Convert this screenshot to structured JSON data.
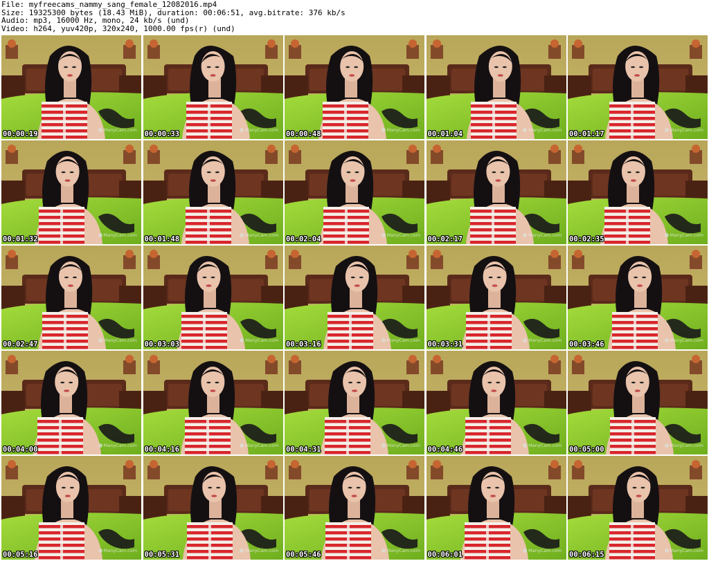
{
  "info": {
    "file": "File: myfreecams_nammy_sang_female_12082016.mp4",
    "size": "Size: 19325300 bytes (18.43 MiB), duration: 00:06:51, avg.bitrate: 376 kb/s",
    "audio": "Audio: mp3, 16000 Hz, mono, 24 kb/s (und)",
    "video": "Video: h264, yuv420p, 320x240, 1000.00 fps(r) (und)"
  },
  "watermark": "ManyCam.com",
  "thumbnails": [
    {
      "timestamp": "00:00:19"
    },
    {
      "timestamp": "00:00:33"
    },
    {
      "timestamp": "00:00:48"
    },
    {
      "timestamp": "00:01:04"
    },
    {
      "timestamp": "00:01:17"
    },
    {
      "timestamp": "00:01:32"
    },
    {
      "timestamp": "00:01:48"
    },
    {
      "timestamp": "00:02:04"
    },
    {
      "timestamp": "00:02:17"
    },
    {
      "timestamp": "00:02:35"
    },
    {
      "timestamp": "00:02:47"
    },
    {
      "timestamp": "00:03:03"
    },
    {
      "timestamp": "00:03:16"
    },
    {
      "timestamp": "00:03:31"
    },
    {
      "timestamp": "00:03:46"
    },
    {
      "timestamp": "00:04:00"
    },
    {
      "timestamp": "00:04:16"
    },
    {
      "timestamp": "00:04:31"
    },
    {
      "timestamp": "00:04:46"
    },
    {
      "timestamp": "00:05:00"
    },
    {
      "timestamp": "00:05:16"
    },
    {
      "timestamp": "00:05:31"
    },
    {
      "timestamp": "00:05:46"
    },
    {
      "timestamp": "00:06:01"
    },
    {
      "timestamp": "00:06:15"
    }
  ],
  "colors": {
    "wall": "#c9b76c",
    "headboard": "#5a2a1a",
    "bedspread": "#8ccc2e",
    "skin": "#e9c3ab",
    "hair": "#141012",
    "stripe_red": "#d8262c",
    "stripe_white": "#f4efe8"
  }
}
